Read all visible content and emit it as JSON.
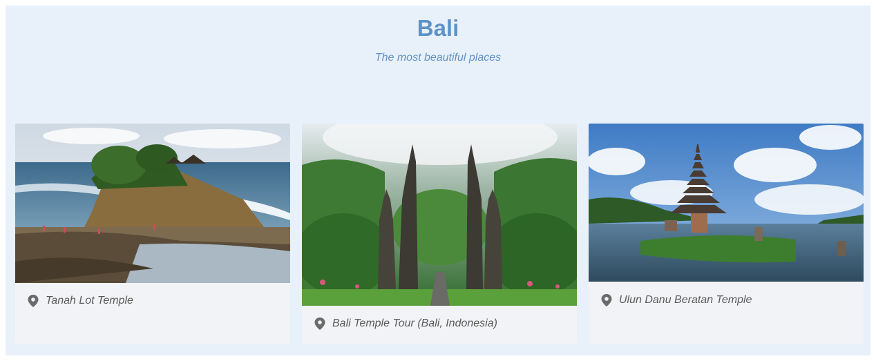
{
  "header": {
    "title": "Bali",
    "subtitle": "The most beautiful places"
  },
  "cards": [
    {
      "caption": "Tanah Lot Temple",
      "icon": "map-pin-icon"
    },
    {
      "caption": "Bali Temple Tour (Bali, Indonesia)",
      "icon": "map-pin-icon"
    },
    {
      "caption": "Ulun Danu Beratan Temple",
      "icon": "map-pin-icon"
    }
  ],
  "colors": {
    "background": "#e8f0fa",
    "accent": "#5f93c6",
    "card": "#f1f3f6",
    "caption_text": "#5a5a5a"
  }
}
